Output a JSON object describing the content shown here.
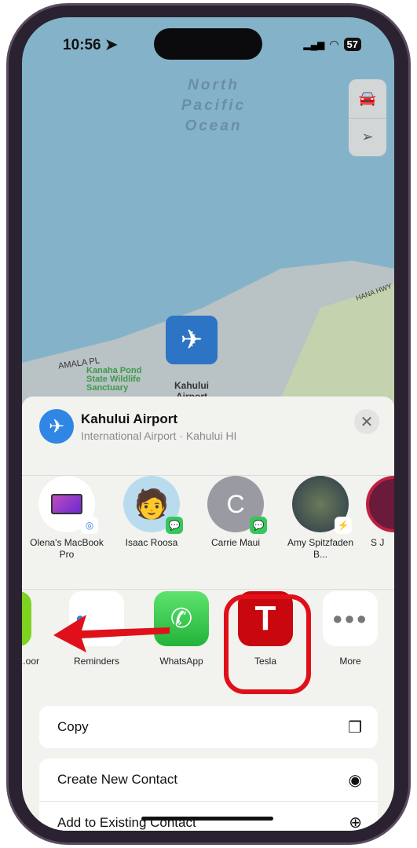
{
  "status": {
    "time": "10:56",
    "battery": "57"
  },
  "map": {
    "ocean_label": [
      "North",
      "Pacific",
      "Ocean"
    ],
    "labels": {
      "road1": "AMALA PL",
      "road2": "HANA HWY",
      "park": "Kanaha Pond State Wildlife Sanctuary",
      "pin": "Kahului Airport (OGG)"
    }
  },
  "sheet": {
    "title": "Kahului Airport",
    "subtitle": "International Airport · Kahului HI",
    "people": [
      {
        "name": "Olena's MacBook Pro",
        "badge": "airdrop"
      },
      {
        "name": "Isaac Roosa",
        "badge": "messages"
      },
      {
        "name": "Carrie Maui",
        "initial": "C",
        "badge": "messages"
      },
      {
        "name": "Amy Spitzfaden B...",
        "badge": "messenger"
      },
      {
        "name": "S J"
      }
    ],
    "apps": [
      {
        "name": "...oor"
      },
      {
        "name": "Reminders"
      },
      {
        "name": "WhatsApp"
      },
      {
        "name": "Tesla"
      },
      {
        "name": "More"
      }
    ],
    "actions": [
      {
        "label": "Copy",
        "icon": "copy-icon"
      },
      {
        "label": "Create New Contact",
        "icon": "person-circle-icon"
      },
      {
        "label": "Add to Existing Contact",
        "icon": "person-add-icon"
      }
    ]
  },
  "colors": {
    "highlight": "#e0101a",
    "accent": "#2f86e4"
  }
}
